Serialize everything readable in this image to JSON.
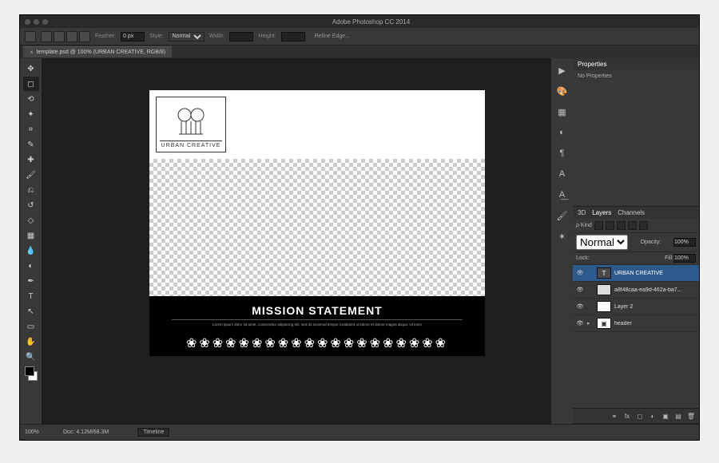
{
  "app": {
    "title": "Adobe Photoshop CC 2014"
  },
  "tab": {
    "label": "template.psd @ 100% (URBAN CREATIVE, RGB/8)",
    "close": "×"
  },
  "options": {
    "feather_label": "Feather:",
    "feather_value": "0 px",
    "style_label": "Style:",
    "style_value": "Normal",
    "width_label": "Width:",
    "height_label": "Height:",
    "refine": "Refine Edge..."
  },
  "tools": [
    {
      "name": "move-tool",
      "glyph": "✥"
    },
    {
      "name": "marquee-tool",
      "glyph": "◻"
    },
    {
      "name": "lasso-tool",
      "glyph": "⟲"
    },
    {
      "name": "wand-tool",
      "glyph": "✦"
    },
    {
      "name": "crop-tool",
      "glyph": "⌗"
    },
    {
      "name": "eyedropper-tool",
      "glyph": "✎"
    },
    {
      "name": "healing-tool",
      "glyph": "✚"
    },
    {
      "name": "brush-tool",
      "glyph": "🖌"
    },
    {
      "name": "stamp-tool",
      "glyph": "⎌"
    },
    {
      "name": "history-brush-tool",
      "glyph": "↺"
    },
    {
      "name": "eraser-tool",
      "glyph": "◇"
    },
    {
      "name": "gradient-tool",
      "glyph": "▦"
    },
    {
      "name": "blur-tool",
      "glyph": "💧"
    },
    {
      "name": "dodge-tool",
      "glyph": "◐"
    },
    {
      "name": "pen-tool",
      "glyph": "✒"
    },
    {
      "name": "type-tool",
      "glyph": "T"
    },
    {
      "name": "path-tool",
      "glyph": "↖"
    },
    {
      "name": "shape-tool",
      "glyph": "▭"
    },
    {
      "name": "hand-tool",
      "glyph": "✋"
    },
    {
      "name": "zoom-tool",
      "glyph": "🔍"
    }
  ],
  "dock": [
    {
      "name": "history-icon",
      "glyph": "▶"
    },
    {
      "name": "color-icon",
      "glyph": "🎨"
    },
    {
      "name": "swatches-icon",
      "glyph": "▦"
    },
    {
      "name": "adjustments-icon",
      "glyph": "◐"
    },
    {
      "name": "paragraph-icon",
      "glyph": "¶"
    },
    {
      "name": "character-icon",
      "glyph": "A"
    },
    {
      "name": "styles-icon",
      "glyph": "A͟"
    },
    {
      "name": "brushes-icon",
      "glyph": "🖌"
    },
    {
      "name": "tool-presets-icon",
      "glyph": "✶"
    }
  ],
  "properties": {
    "title": "Properties",
    "body": "No Properties"
  },
  "layers_panel": {
    "tabs": {
      "threeD": "3D",
      "layers": "Layers",
      "channels": "Channels"
    },
    "kind_label": "ρ Kind",
    "blend_mode": "Normal",
    "opacity_label": "Opacity:",
    "opacity_value": "100%",
    "lock_label": "Lock:",
    "fill_label": "Fill:",
    "fill_value": "100%",
    "layers": [
      {
        "name": "URBAN CREATIVE",
        "type": "text",
        "selected": true,
        "visible": true
      },
      {
        "name": "a8f48caa-ea9d-462a-ba7...",
        "type": "image",
        "selected": false,
        "visible": true
      },
      {
        "name": "Layer 2",
        "type": "raster",
        "selected": false,
        "visible": true
      },
      {
        "name": "header",
        "type": "group",
        "selected": false,
        "visible": true
      }
    ]
  },
  "document": {
    "logo_text": "URBAN CREATIVE",
    "mission_title": "MISSION STATEMENT",
    "mission_body": "Lorem ipsum dolor sit amet, consectetur adipiscing elit, sed do eiusmod tempor incididunt ut labore et dolore magna aliqua. Ut enim",
    "pattern": "❀❀❀❀❀❀❀❀❀❀❀❀❀❀❀❀❀❀❀❀"
  },
  "status": {
    "zoom": "100%",
    "doc": "Doc: 4.12M/68.3M",
    "timeline": "Timeline"
  }
}
